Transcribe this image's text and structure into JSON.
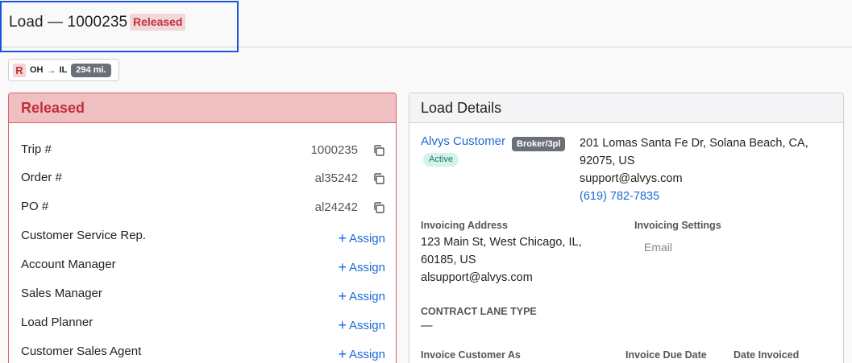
{
  "header": {
    "title": "Load — 1000235",
    "status": "Released"
  },
  "route": {
    "badge": "R",
    "origin": "OH",
    "arrow": "→",
    "destination": "IL",
    "distance": "294 mi."
  },
  "released_card": {
    "title": "Released",
    "rows": [
      {
        "label": "Trip #",
        "value": "1000235",
        "icon": "copy-icon"
      },
      {
        "label": "Order #",
        "value": "al35242",
        "icon": "copy-icon"
      },
      {
        "label": "PO #",
        "value": "al24242",
        "icon": "copy-icon"
      },
      {
        "label": "Customer Service Rep.",
        "action": "Assign"
      },
      {
        "label": "Account Manager",
        "action": "Assign"
      },
      {
        "label": "Sales Manager",
        "action": "Assign"
      },
      {
        "label": "Load Planner",
        "action": "Assign"
      },
      {
        "label": "Customer Sales Agent",
        "action": "Assign"
      }
    ],
    "assign_plus": "+"
  },
  "load_details": {
    "title": "Load Details",
    "customer": {
      "name": "Alvys Customer",
      "type_badge": "Broker/3pl",
      "status_badge": "Active",
      "address_line1": "201 Lomas Santa Fe Dr, Solana Beach, CA,",
      "address_line2": "92075, US",
      "email": "support@alvys.com",
      "phone": "(619) 782-7835"
    },
    "invoicing_address": {
      "label": "Invoicing Address",
      "line1": "123 Main St, West Chicago, IL,",
      "line2": "60185, US",
      "email": "alsupport@alvys.com"
    },
    "invoicing_settings": {
      "label": "Invoicing Settings",
      "value": "Email"
    },
    "contract_lane_type": {
      "label": "CONTRACT LANE TYPE",
      "value": "—"
    },
    "invoice_customer_as": {
      "label": "Invoice Customer As"
    },
    "invoice_due_date": {
      "label": "Invoice Due Date"
    },
    "date_invoiced": {
      "label": "Date Invoiced"
    }
  },
  "colors": {
    "accent": "#1a6ad6",
    "released_red": "#c0303b",
    "released_bg": "#f0bfc2",
    "focus_outline": "#1a56db"
  }
}
